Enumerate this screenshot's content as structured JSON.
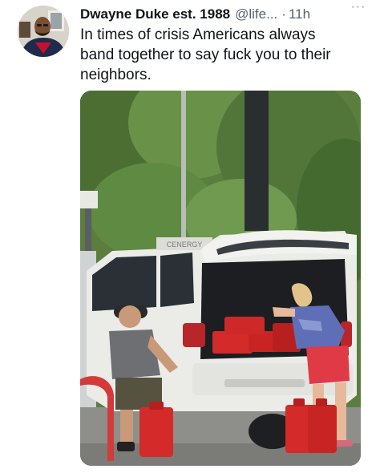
{
  "tweet": {
    "display_name": "Dwayne Duke est. 1988",
    "handle": "@life...",
    "separator": "·",
    "time": "11h",
    "more_label": "···",
    "text_lines": [
      "In times of crisis Americans always",
      "band together to say fuck you to their",
      "neighbors."
    ],
    "photo": {
      "sign_text": "CENERGY"
    }
  },
  "colors": {
    "text_primary": "#0f1419",
    "text_secondary": "#536471",
    "gas_can_red": "#d42a2a"
  }
}
